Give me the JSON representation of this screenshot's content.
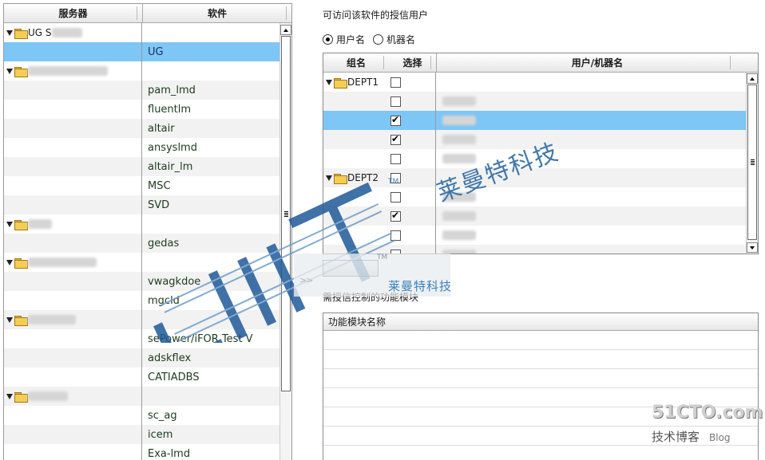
{
  "left": {
    "col_server": "服务器",
    "col_software": "软件",
    "rows": [
      {
        "type": "group",
        "server": "UG S",
        "software": ""
      },
      {
        "type": "item",
        "software": "UG",
        "selected": true
      },
      {
        "type": "group",
        "server": "",
        "software": ""
      },
      {
        "type": "item",
        "software": "pam_lmd"
      },
      {
        "type": "item",
        "software": "fluentlm"
      },
      {
        "type": "item",
        "software": "altair"
      },
      {
        "type": "item",
        "software": "ansyslmd"
      },
      {
        "type": "item",
        "software": "altair_lm"
      },
      {
        "type": "item",
        "software": "MSC"
      },
      {
        "type": "item",
        "software": "SVD"
      },
      {
        "type": "group",
        "server": "",
        "software": ""
      },
      {
        "type": "item",
        "software": "gedas"
      },
      {
        "type": "group",
        "server": "",
        "software": ""
      },
      {
        "type": "item",
        "software": "vwagkdoe"
      },
      {
        "type": "item",
        "software": "mgcld"
      },
      {
        "type": "group",
        "server": "",
        "software": ""
      },
      {
        "type": "item",
        "software": "sePower/iFOR Test V"
      },
      {
        "type": "item",
        "software": "adskflex"
      },
      {
        "type": "item",
        "software": "CATIADBS"
      },
      {
        "type": "group",
        "server": "",
        "software": ""
      },
      {
        "type": "item",
        "software": "sc_ag"
      },
      {
        "type": "item",
        "software": "icem"
      },
      {
        "type": "item",
        "software": "Exa-lmd"
      }
    ]
  },
  "right": {
    "authorized_title": "可访问该软件的授信用户",
    "radio_user": "用户名",
    "radio_machine": "机器名",
    "col_group": "组名",
    "col_select": "选择",
    "col_user": "用户/机器名",
    "users": [
      {
        "type": "group",
        "group": "DEPT1",
        "checked": false
      },
      {
        "type": "user",
        "checked": false
      },
      {
        "type": "user",
        "checked": true,
        "selected": true
      },
      {
        "type": "user",
        "checked": true
      },
      {
        "type": "user",
        "checked": false
      },
      {
        "type": "group",
        "group": "DEPT2",
        "checked": false
      },
      {
        "type": "user",
        "checked": false
      },
      {
        "type": "user",
        "checked": true
      },
      {
        "type": "user",
        "checked": false
      },
      {
        "type": "user",
        "checked": false
      }
    ],
    "assign_arrow": ">>",
    "modules_caption": "需授信控制的功能模块",
    "col_module": "功能模块名称"
  },
  "watermark": {
    "logo_tm": "TM",
    "logo_tm2": "TM",
    "logo_company": "莱曼特科技",
    "diag_company": "莱曼特科技",
    "site": "51CTO.com",
    "blog_cn": "技术博客",
    "blog_en": "Blog"
  },
  "colors": {
    "selection": "#7ec6f5",
    "watermark_blue": "#2e6aa3"
  }
}
